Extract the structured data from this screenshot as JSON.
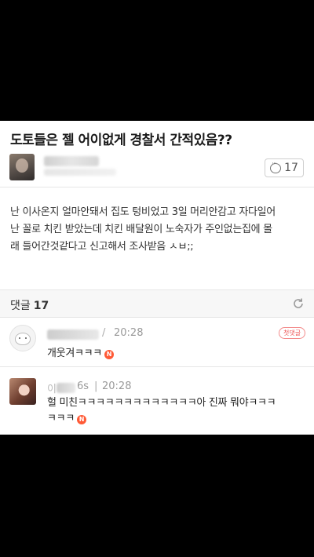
{
  "post": {
    "title": "도토들은 젤 어이없게 경찰서 간적있음??",
    "comment_count": "17",
    "body_lines": [
      "난 이사온지 얼마안돼서 집도 텅비었고 3일 머리안감고 자다일어",
      "난 꼴로 치킨 받았는데 치킨 배달원이 노숙자가 주인없는집에 몰",
      "래 들어간것같다고 신고해서 조사받음 ㅅㅂ;;"
    ]
  },
  "comments_header": {
    "label": "댓글",
    "count": "17"
  },
  "comments": [
    {
      "sep": "/",
      "time": "20:28",
      "badge": "첫댓글",
      "text": "개웃겨ㅋㅋㅋ",
      "new_mark": "N"
    },
    {
      "name_partial": "이",
      "name_suffix": "6s",
      "time": "20:28",
      "text_lines": [
        "헐 미친ㅋㅋㅋㅋㅋㅋㅋㅋㅋㅋㅋㅋㅋ아 진짜 뭐야ㅋㅋㅋ",
        "ㅋㅋㅋ"
      ],
      "new_mark": "N"
    }
  ],
  "icons": {
    "comment": "comment-bubble-icon",
    "refresh": "refresh-icon"
  },
  "colors": {
    "new_badge": "#ff5a36",
    "first_comment_badge": "#ee5555"
  }
}
